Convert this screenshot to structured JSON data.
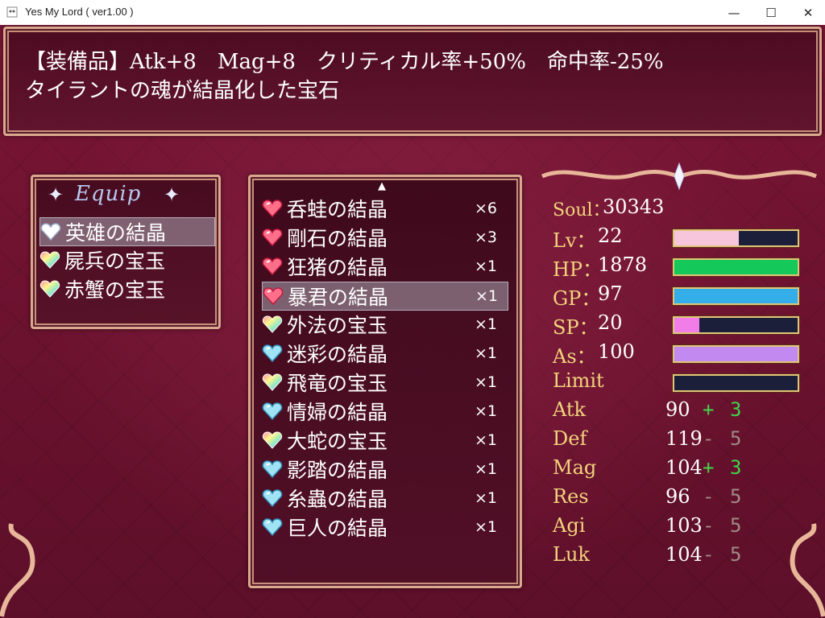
{
  "window": {
    "title": "Yes My Lord ( ver1.00 )",
    "minimize_glyph": "—",
    "maximize_glyph": "☐",
    "close_glyph": "✕"
  },
  "help": {
    "line1": "【装備品】Atk+8　Mag+8　クリティカル率+50%　命中率-25%",
    "line2": "タイラントの魂が結晶化した宝石"
  },
  "equip": {
    "title": "Equip",
    "slots": [
      {
        "name": "英雄の結晶",
        "gem": "clear-gem-icon",
        "selected": true
      },
      {
        "name": "屍兵の宝玉",
        "gem": "rainbow-gem-icon",
        "selected": false
      },
      {
        "name": "赤蟹の宝玉",
        "gem": "rainbow-gem-icon",
        "selected": false
      }
    ]
  },
  "items": {
    "scroll_up_glyph": "▲",
    "list": [
      {
        "name": "呑蛙の結晶",
        "qty": "×6",
        "gem": "red-heart-gem-icon",
        "selected": false
      },
      {
        "name": "剛石の結晶",
        "qty": "×3",
        "gem": "red-heart-gem-icon",
        "selected": false
      },
      {
        "name": "狂猪の結晶",
        "qty": "×1",
        "gem": "red-heart-gem-icon",
        "selected": false
      },
      {
        "name": "暴君の結晶",
        "qty": "×1",
        "gem": "red-heart-gem-icon",
        "selected": true
      },
      {
        "name": "外法の宝玉",
        "qty": "×1",
        "gem": "rainbow-gem-icon",
        "selected": false
      },
      {
        "name": "迷彩の結晶",
        "qty": "×1",
        "gem": "blue-heart-gem-icon",
        "selected": false
      },
      {
        "name": "飛竜の宝玉",
        "qty": "×1",
        "gem": "rainbow-gem-icon",
        "selected": false
      },
      {
        "name": "情婦の結晶",
        "qty": "×1",
        "gem": "blue-heart-gem-icon",
        "selected": false
      },
      {
        "name": "大蛇の宝玉",
        "qty": "×1",
        "gem": "rainbow-gem-icon",
        "selected": false
      },
      {
        "name": "影踏の結晶",
        "qty": "×1",
        "gem": "blue-heart-gem-icon",
        "selected": false
      },
      {
        "name": "糸蟲の結晶",
        "qty": "×1",
        "gem": "blue-heart-gem-icon",
        "selected": false
      },
      {
        "name": "巨人の結晶",
        "qty": "×1",
        "gem": "blue-heart-gem-icon",
        "selected": false
      }
    ]
  },
  "status": {
    "soul": {
      "label": "Soul",
      "value": "30343"
    },
    "gauges": [
      {
        "label": "Lv",
        "sep": "：",
        "value": "22",
        "fill": 0.52,
        "color": "#f7c6dc"
      },
      {
        "label": "HP",
        "sep": "：",
        "value": "1878",
        "fill": 1.0,
        "color": "#14c85a"
      },
      {
        "label": "GP",
        "sep": "：",
        "value": "97",
        "fill": 1.0,
        "color": "#33aee8"
      },
      {
        "label": "SP",
        "sep": "：",
        "value": "20",
        "fill": 0.2,
        "color": "#f17ee8"
      },
      {
        "label": "As",
        "sep": "：",
        "value": "100",
        "fill": 1.0,
        "color": "#c28af0"
      },
      {
        "label": "Limit",
        "sep": "",
        "value": "",
        "fill": 0.0,
        "color": "#e85a5a"
      }
    ],
    "params": [
      {
        "label": "Atk",
        "value": "90",
        "sign": "+",
        "delta": "3",
        "color": "#42d44a"
      },
      {
        "label": "Def",
        "value": "119",
        "sign": "-",
        "delta": "5",
        "color": "#a08a86"
      },
      {
        "label": "Mag",
        "value": "104",
        "sign": "+",
        "delta": "3",
        "color": "#42d44a"
      },
      {
        "label": "Res",
        "value": "96",
        "sign": "-",
        "delta": "5",
        "color": "#a08a86"
      },
      {
        "label": "Agi",
        "value": "103",
        "sign": "-",
        "delta": "5",
        "color": "#a08a86"
      },
      {
        "label": "Luk",
        "value": "104",
        "sign": "-",
        "delta": "5",
        "color": "#a08a86"
      }
    ]
  }
}
